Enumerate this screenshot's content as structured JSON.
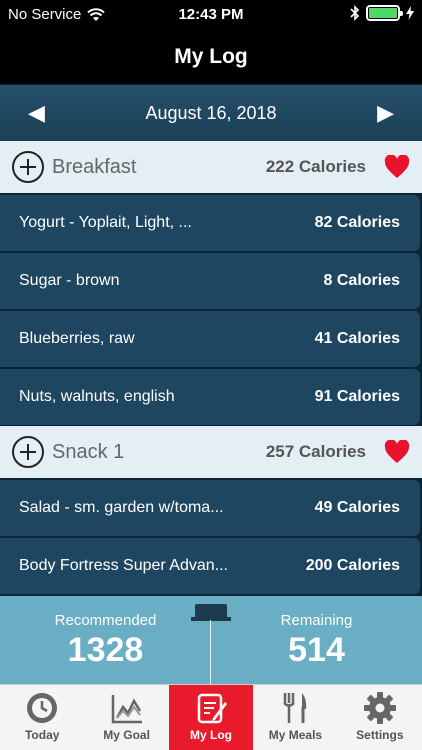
{
  "status": {
    "carrier": "No Service",
    "time": "12:43 PM"
  },
  "header": {
    "title": "My Log"
  },
  "date_nav": {
    "date": "August 16, 2018"
  },
  "sections": [
    {
      "name": "Breakfast",
      "calories": "222 Calories",
      "items": [
        {
          "name": "Yogurt - Yoplait, Light, ...",
          "calories": "82 Calories"
        },
        {
          "name": "Sugar - brown",
          "calories": "8 Calories"
        },
        {
          "name": "Blueberries, raw",
          "calories": "41 Calories"
        },
        {
          "name": "Nuts, walnuts, english",
          "calories": "91 Calories"
        }
      ]
    },
    {
      "name": "Snack 1",
      "calories": "257 Calories",
      "items": [
        {
          "name": "Salad - sm. garden w/toma...",
          "calories": "49 Calories"
        },
        {
          "name": "Body Fortress Super Advan...",
          "calories": "200 Calories"
        }
      ]
    }
  ],
  "summary": {
    "recommended_label": "Recommended",
    "recommended_value": "1328",
    "remaining_label": "Remaining",
    "remaining_value": "514"
  },
  "tabs": [
    {
      "label": "Today",
      "icon": "clock-icon"
    },
    {
      "label": "My Goal",
      "icon": "chart-icon"
    },
    {
      "label": "My Log",
      "icon": "notepad-icon"
    },
    {
      "label": "My Meals",
      "icon": "fork-knife-icon"
    },
    {
      "label": "Settings",
      "icon": "gear-icon"
    }
  ],
  "colors": {
    "active_tab": "#e81a2b",
    "heart": "#e8132a",
    "row_bg": "#1e4660",
    "summary_bg": "#6aaec6"
  }
}
